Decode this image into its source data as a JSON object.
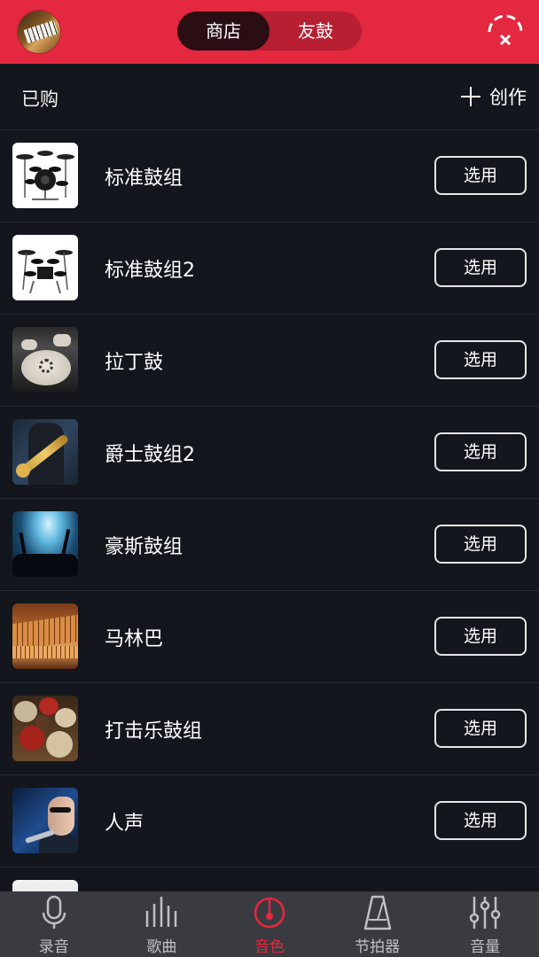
{
  "header": {
    "tabs": [
      {
        "label": "商店",
        "active": true
      },
      {
        "label": "友鼓",
        "active": false
      }
    ],
    "accent_color": "#e3283f"
  },
  "subbar": {
    "purchased_label": "已购",
    "create_label": "创作"
  },
  "kits": [
    {
      "name": "标准鼓组",
      "button": "选用",
      "thumb": "drum-kit-image"
    },
    {
      "name": "标准鼓组2",
      "button": "选用",
      "thumb": "drum-kit-image"
    },
    {
      "name": "拉丁鼓",
      "button": "选用",
      "thumb": "latin-drum-image"
    },
    {
      "name": "爵士鼓组2",
      "button": "选用",
      "thumb": "saxophone-image"
    },
    {
      "name": "豪斯鼓组",
      "button": "选用",
      "thumb": "concert-crowd-image"
    },
    {
      "name": "马林巴",
      "button": "选用",
      "thumb": "marimba-image"
    },
    {
      "name": "打击乐鼓组",
      "button": "选用",
      "thumb": "percussion-image"
    },
    {
      "name": "人声",
      "button": "选用",
      "thumb": "singer-image"
    }
  ],
  "bottom_nav": [
    {
      "label": "录音",
      "icon": "microphone-icon",
      "active": false
    },
    {
      "label": "歌曲",
      "icon": "bars-icon",
      "active": false
    },
    {
      "label": "音色",
      "icon": "tone-dial-icon",
      "active": true
    },
    {
      "label": "节拍器",
      "icon": "metronome-icon",
      "active": false
    },
    {
      "label": "音量",
      "icon": "sliders-icon",
      "active": false
    }
  ]
}
